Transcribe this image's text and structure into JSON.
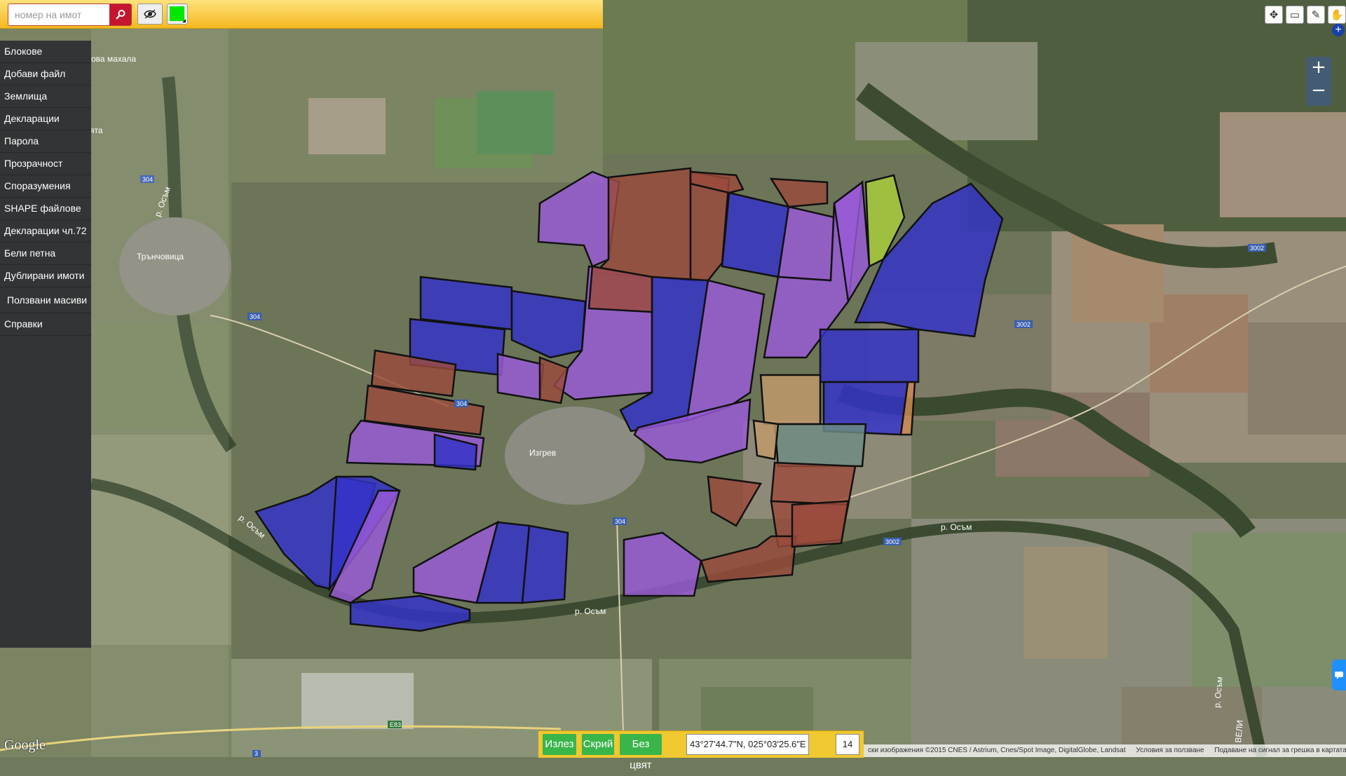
{
  "search": {
    "placeholder": "номер на имот"
  },
  "toolbar": {
    "color_swatch": "#00e600"
  },
  "sidebar": {
    "items": [
      {
        "label": "Блокове"
      },
      {
        "label": "Добави файл"
      },
      {
        "label": "Землища"
      },
      {
        "label": "Декларации"
      },
      {
        "label": "Парола"
      },
      {
        "label": "Прозрачност"
      },
      {
        "label": "Споразумения"
      },
      {
        "label": "SHAPE файлове"
      },
      {
        "label": "Декларации чл.72"
      },
      {
        "label": "Бели петна"
      },
      {
        "label": "Дублирани имоти"
      },
      {
        "label": "Ползвани масиви"
      },
      {
        "label": "Справки"
      }
    ]
  },
  "map": {
    "labels": {
      "village_main": "Изгрев",
      "village_west": "Трънчовица",
      "village_nw": "ова махала",
      "village_nw2": "ята",
      "river_1": "р. Осъм",
      "river_2": "р. Осъм",
      "river_3": "р. Осъм",
      "river_4": "р. Осъм",
      "river_5": "р. Осъм",
      "road_304a": "304",
      "road_304b": "304",
      "road_304c": "304",
      "road_304d": "304",
      "road_3002a": "3002",
      "road_3002b": "3002",
      "road_3002c": "3002",
      "road_e83": "E83",
      "road_3": "3",
      "velik": "ВЕЛИ"
    }
  },
  "bottom": {
    "exit_label": "Излез",
    "hide_label": "Скрий",
    "nocolor_label": "Без цвят",
    "coordinates": "43°27'44.7\"N, 025°03'25.6\"E",
    "zoom_level": "14"
  },
  "attribution": {
    "imagery": "ски изображения ©2015 CNES / Astrium, Cnes/Spot Image, DigitalGlobe, Landsat",
    "terms": "Условия за ползване",
    "report": "Подаване на сигнал за грешка в картата"
  },
  "google": "Google"
}
